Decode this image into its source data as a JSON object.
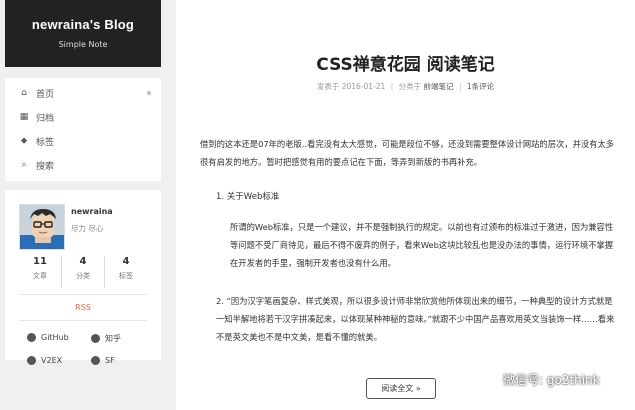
{
  "brand": {
    "title": "newraina's Blog",
    "subtitle": "Simple Note"
  },
  "menu": [
    {
      "label": "首页",
      "icon": "home-icon",
      "glyph": "⌂"
    },
    {
      "label": "归档",
      "icon": "archive-icon",
      "glyph": "▦"
    },
    {
      "label": "标签",
      "icon": "tags-icon",
      "glyph": "⬥"
    },
    {
      "label": "搜索",
      "icon": "search-icon",
      "glyph": "⌕"
    }
  ],
  "profile": {
    "name": "newraina",
    "motto": "尽力 尽心",
    "stats": [
      {
        "num": "11",
        "label": "文章"
      },
      {
        "num": "4",
        "label": "分类"
      },
      {
        "num": "4",
        "label": "标签"
      }
    ],
    "rss": "RSS",
    "social": [
      {
        "label": "GitHub",
        "icon": "github-icon"
      },
      {
        "label": "知乎",
        "icon": "zhihu-icon"
      },
      {
        "label": "V2EX",
        "icon": "v2ex-icon"
      },
      {
        "label": "SF",
        "icon": "sf-icon"
      }
    ]
  },
  "post": {
    "title": "CSS禅意花园 阅读笔记",
    "meta": {
      "date": "发表于 2016-01-21",
      "sep": "|",
      "category_prefix": "分类于",
      "category": "前端笔记",
      "comments": "1条评论"
    },
    "p1": "借到的这本还是07年的老版..看完没有太大感觉，可能是段位不够，还没到需要整体设计网站的层次，并没有太多很有启发的地方。暂时把感觉有用的要点记在下面，等弄到新版的书再补充。",
    "h1": "1. 关于Web标准",
    "p2": "所谓的Web标准，只是一个建议，并不是强制执行的规定。以前也有过颁布的标准过于激进，因为兼容性等问题不受厂商待见，最后不得不废弃的例子，看来Web这块比较乱也是没办法的事情，运行环境不掌握在开发者的手里，强制开发者也没有什么用。",
    "h2": "2. “因为汉字笔画复杂、样式美观，所以很多设计师非常欣赏他所体现出来的细节，一种典型的设计方式就是一知半解地将若干汉字拼凑起来，以体现某种神秘的意味。”就跟不少中国产品喜欢用英文当装饰一样……看来不是英文美也不是中文美，是看不懂的就美。",
    "more": "阅读全文 »"
  },
  "watermark": {
    "text": "微信号: go2think"
  }
}
